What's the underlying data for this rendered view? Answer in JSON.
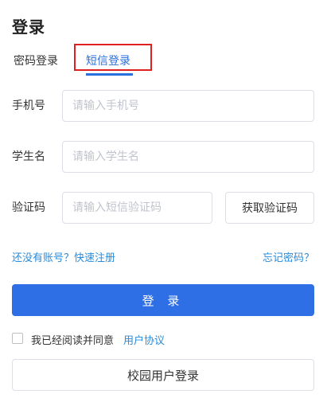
{
  "page": {
    "title": "登录"
  },
  "tabs": [
    {
      "label": "密码登录",
      "active": false
    },
    {
      "label": "短信登录",
      "active": true
    }
  ],
  "fields": {
    "phone": {
      "label": "手机号",
      "placeholder": "请输入手机号",
      "value": ""
    },
    "student_name": {
      "label": "学生名",
      "placeholder": "请输入学生名",
      "value": ""
    },
    "code": {
      "label": "验证码",
      "placeholder": "请输入短信验证码",
      "value": "",
      "button_label": "获取验证码"
    }
  },
  "links": {
    "register": "还没有账号？快速注册",
    "forgot": "忘记密码？"
  },
  "login_button": "登 录",
  "agreement": {
    "checked": false,
    "text": "我已经阅读并同意",
    "link": "用户协议"
  },
  "campus_button": "校园用户登录",
  "colors": {
    "primary": "#2f6fe6",
    "link": "#2a8bd8",
    "highlight": "#e02020"
  }
}
